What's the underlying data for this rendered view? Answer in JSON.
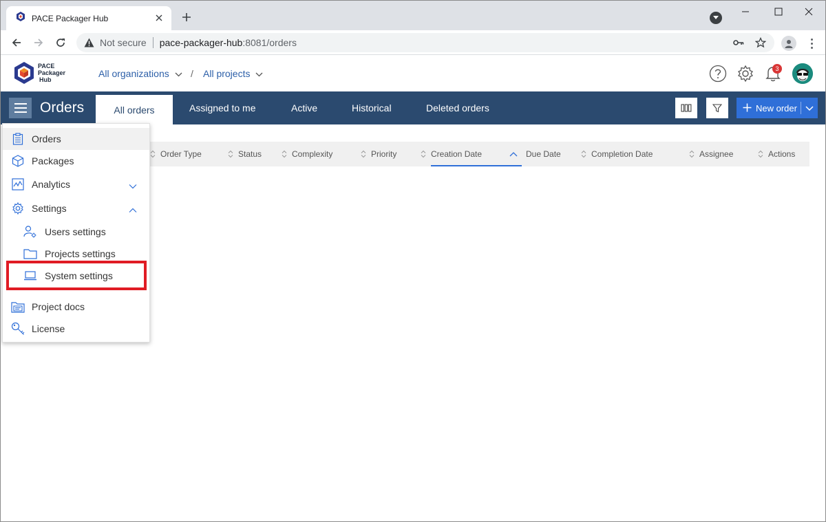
{
  "browser": {
    "tab_title": "PACE Packager Hub",
    "security_label": "Not secure",
    "url_host": "pace-packager-hub",
    "url_rest": ":8081/orders"
  },
  "header": {
    "logo_lines": [
      "PACE",
      "Packager",
      "Hub"
    ],
    "org_selector": "All organizations",
    "crumb_separator": "/",
    "project_selector": "All projects",
    "notification_count": "3"
  },
  "navbar": {
    "title": "Orders",
    "tabs": [
      {
        "label": "All orders",
        "active": true
      },
      {
        "label": "Assigned to me",
        "active": false
      },
      {
        "label": "Active",
        "active": false
      },
      {
        "label": "Historical",
        "active": false
      },
      {
        "label": "Deleted orders",
        "active": false
      }
    ],
    "new_order_label": "New order"
  },
  "table": {
    "columns": [
      "Order Type",
      "Status",
      "Complexity",
      "Priority",
      "Creation Date",
      "Due Date",
      "Completion Date",
      "Assignee",
      "Actions"
    ],
    "sorted_column": "Creation Date",
    "sort_direction": "ascending"
  },
  "menu": {
    "items": [
      {
        "label": "Orders",
        "icon": "clipboard-icon",
        "selected": true
      },
      {
        "label": "Packages",
        "icon": "cube-icon"
      },
      {
        "label": "Analytics",
        "icon": "chart-icon",
        "expandable": "collapsed"
      },
      {
        "label": "Settings",
        "icon": "gear-icon",
        "expandable": "expanded"
      },
      {
        "label": "Users settings",
        "icon": "user-gear-icon",
        "sub": true
      },
      {
        "label": "Projects settings",
        "icon": "folder-icon",
        "sub": true
      },
      {
        "label": "System settings",
        "icon": "laptop-icon",
        "sub": true,
        "highlighted": true
      },
      {
        "label": "Project docs",
        "icon": "docs-icon"
      },
      {
        "label": "License",
        "icon": "key-icon"
      }
    ]
  },
  "colors": {
    "navbar": "#2b4a6f",
    "accent": "#2f6fd8",
    "highlight": "#e01b24",
    "badge": "#d93636"
  }
}
